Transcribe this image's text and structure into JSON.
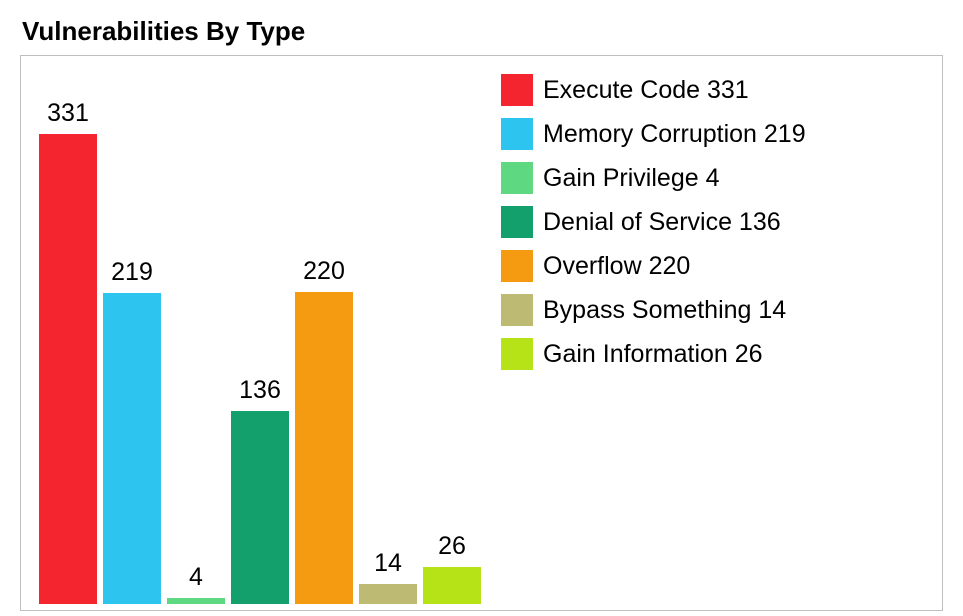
{
  "title": "Vulnerabilities By Type",
  "chart_data": {
    "type": "bar",
    "ylim": [
      0,
      331
    ],
    "categories": [
      "Execute Code",
      "Memory Corruption",
      "Gain Privilege",
      "Denial of Service",
      "Overflow",
      "Bypass Something",
      "Gain Information"
    ],
    "values": [
      331,
      219,
      4,
      136,
      220,
      14,
      26
    ],
    "series": [
      {
        "name": "Execute Code",
        "value": 331,
        "color": "#f4252e"
      },
      {
        "name": "Memory Corruption",
        "value": 219,
        "color": "#2ec4f0"
      },
      {
        "name": "Gain Privilege",
        "value": 4,
        "color": "#5fd981"
      },
      {
        "name": "Denial of Service",
        "value": 136,
        "color": "#13a06c"
      },
      {
        "name": "Overflow",
        "value": 220,
        "color": "#f49b12"
      },
      {
        "name": "Bypass Something",
        "value": 14,
        "color": "#bdbb73"
      },
      {
        "name": "Gain Information",
        "value": 26,
        "color": "#b5e318"
      }
    ]
  }
}
